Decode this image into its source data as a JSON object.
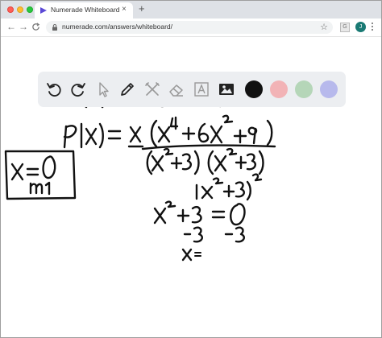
{
  "browser": {
    "tab_title": "Numerade Whiteboard",
    "tab_close": "×",
    "new_tab": "+",
    "url": "numerade.com/answers/whiteboard/",
    "back": "←",
    "forward": "→",
    "reload": "C",
    "star": "☆",
    "extension_label": "G",
    "avatar_initial": "J"
  },
  "palette": {
    "tools": [
      "undo-icon",
      "redo-icon",
      "pointer-icon",
      "pen-icon",
      "tools-icon",
      "eraser-icon",
      "text-icon",
      "image-icon"
    ],
    "colors": [
      "#111111",
      "#f2b3b6",
      "#b5d6b8",
      "#b7b9ec"
    ],
    "selected_color": "#111111"
  },
  "whiteboard": {
    "strokes_description_none": ""
  }
}
